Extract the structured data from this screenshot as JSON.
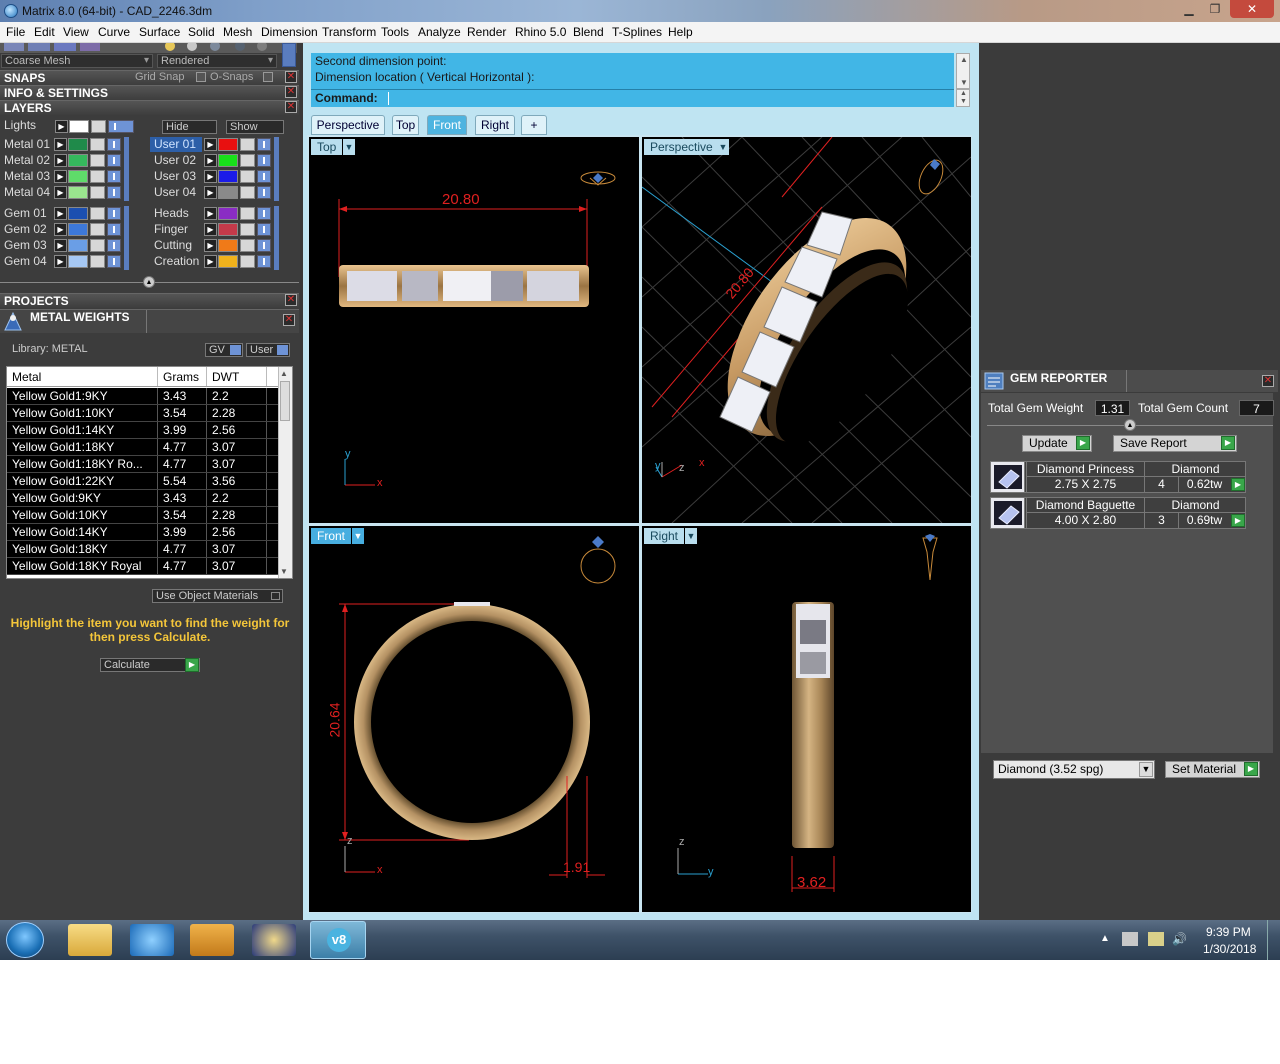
{
  "window": {
    "title": "Matrix 8.0 (64-bit) - CAD_2246.3dm",
    "minimize": "▁",
    "maximize": "❐",
    "close": "✕"
  },
  "menu": [
    "File",
    "Edit",
    "View",
    "Curve",
    "Surface",
    "Solid",
    "Mesh",
    "Dimension",
    "Transform",
    "Tools",
    "Analyze",
    "Render",
    "Rhino 5.0",
    "Blend",
    "T-Splines",
    "Help"
  ],
  "left": {
    "mesh_mode": "Coarse Mesh",
    "render_mode": "Rendered",
    "snaps": {
      "label": "SNAPS",
      "grid_snap": "Grid Snap",
      "osnaps": "O-Snaps"
    },
    "info": "INFO & SETTINGS",
    "layers": {
      "label": "LAYERS",
      "lights": "Lights",
      "hide": "Hide",
      "show": "Show",
      "metal_layers": [
        {
          "name": "Metal 01",
          "color": "#1f8a4a"
        },
        {
          "name": "Metal 02",
          "color": "#35b85d"
        },
        {
          "name": "Metal 03",
          "color": "#5fdc6a"
        },
        {
          "name": "Metal 04",
          "color": "#9ae48e"
        }
      ],
      "user_layers": [
        {
          "name": "User 01",
          "color": "#e81010",
          "selected": true
        },
        {
          "name": "User 02",
          "color": "#18e01a",
          "selected": false
        },
        {
          "name": "User 03",
          "color": "#1b1be8",
          "selected": false
        },
        {
          "name": "User 04",
          "color": "#8a8a8a",
          "selected": false
        }
      ],
      "gem_layers": [
        {
          "name": "Gem 01",
          "color": "#1c4fb0"
        },
        {
          "name": "Gem 02",
          "color": "#3d78d8"
        },
        {
          "name": "Gem 03",
          "color": "#6a9ee6"
        },
        {
          "name": "Gem 04",
          "color": "#a6c8f4"
        }
      ],
      "other_layers": [
        {
          "name": "Heads",
          "color": "#8a2cc4"
        },
        {
          "name": "Finger",
          "color": "#c43a4a"
        },
        {
          "name": "Cutting",
          "color": "#f07a18"
        },
        {
          "name": "Creation",
          "color": "#f0b21c"
        }
      ]
    },
    "projects": "PROJECTS",
    "metal_weights": {
      "title": "METAL WEIGHTS",
      "library": "Library: METAL",
      "gv_btn": "GV",
      "user_btn": "User",
      "columns": [
        "Metal",
        "Grams",
        "DWT"
      ],
      "rows": [
        [
          "Yellow Gold1:9KY",
          "3.43",
          "2.2"
        ],
        [
          "Yellow Gold1:10KY",
          "3.54",
          "2.28"
        ],
        [
          "Yellow Gold1:14KY",
          "3.99",
          "2.56"
        ],
        [
          "Yellow Gold1:18KY",
          "4.77",
          "3.07"
        ],
        [
          "Yellow Gold1:18KY Ro...",
          "4.77",
          "3.07"
        ],
        [
          "Yellow Gold1:22KY",
          "5.54",
          "3.56"
        ],
        [
          "Yellow Gold:9KY",
          "3.43",
          "2.2"
        ],
        [
          "Yellow Gold:10KY",
          "3.54",
          "2.28"
        ],
        [
          "Yellow Gold:14KY",
          "3.99",
          "2.56"
        ],
        [
          "Yellow Gold:18KY",
          "4.77",
          "3.07"
        ],
        [
          "Yellow Gold:18KY Royal",
          "4.77",
          "3.07"
        ]
      ],
      "use_object_materials": "Use Object Materials",
      "hint": "Highlight the item you want to find the weight for then press Calculate.",
      "calculate": "Calculate"
    }
  },
  "command": {
    "line1": "Second dimension point:",
    "line2": "Dimension location ( Vertical  Horizontal ):",
    "prompt": "Command:"
  },
  "viewport_tabs": [
    "Perspective",
    "Top",
    "Front",
    "Right",
    "+"
  ],
  "viewports": {
    "top": {
      "label": "Top",
      "dim": "20.80"
    },
    "perspective": {
      "label": "Perspective",
      "dim": "20.80"
    },
    "front": {
      "label": "Front",
      "dim_height": "20.64",
      "dim_width": "1.91"
    },
    "right": {
      "label": "Right",
      "dim": "3.62"
    },
    "axes": {
      "x": "x",
      "y": "y",
      "z": "z"
    }
  },
  "gem_reporter": {
    "title": "GEM REPORTER",
    "total_weight_label": "Total Gem Weight",
    "total_weight": "1.31",
    "total_count_label": "Total Gem Count",
    "total_count": "7",
    "update": "Update",
    "save_report": "Save Report",
    "gems": [
      {
        "name": "Diamond Princess",
        "material": "Diamond",
        "size": "2.75 X 2.75",
        "count": "4",
        "weight": "0.62tw"
      },
      {
        "name": "Diamond Baguette",
        "material": "Diamond",
        "size": "4.00 X 2.80",
        "count": "3",
        "weight": "0.69tw"
      }
    ],
    "material_select": "Diamond     (3.52 spg)",
    "set_material": "Set Material"
  },
  "taskbar": {
    "time": "9:39 PM",
    "date": "1/30/2018"
  }
}
